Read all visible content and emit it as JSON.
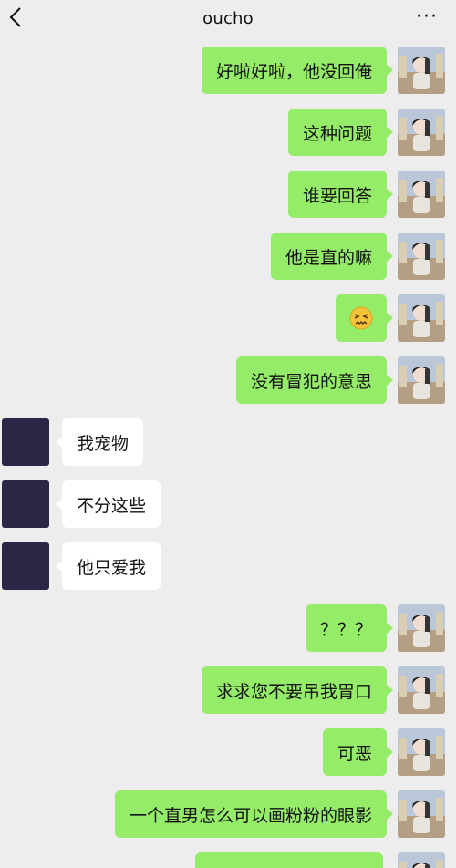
{
  "header": {
    "title": "oucho",
    "more_label": "···"
  },
  "messages": [
    {
      "side": "out",
      "text": "好啦好啦，他没回俺"
    },
    {
      "side": "out",
      "text": "这种问题"
    },
    {
      "side": "out",
      "text": "谁要回答"
    },
    {
      "side": "out",
      "text": "他是直的嘛"
    },
    {
      "side": "out",
      "text": "😖"
    },
    {
      "side": "out",
      "text": "没有冒犯的意思"
    },
    {
      "side": "in",
      "text": "我宠物"
    },
    {
      "side": "in",
      "text": "不分这些"
    },
    {
      "side": "in",
      "text": "他只爱我"
    },
    {
      "side": "out",
      "text": "？？？"
    },
    {
      "side": "out",
      "text": "求求您不要吊我胃口"
    },
    {
      "side": "out",
      "text": "可恶"
    },
    {
      "side": "out",
      "text": "一个直男怎么可以画粉粉的眼影"
    }
  ],
  "colors": {
    "background": "#ededed",
    "outgoing_bubble": "#95ec69",
    "incoming_bubble": "#ffffff",
    "incoming_avatar": "#2b2546"
  }
}
